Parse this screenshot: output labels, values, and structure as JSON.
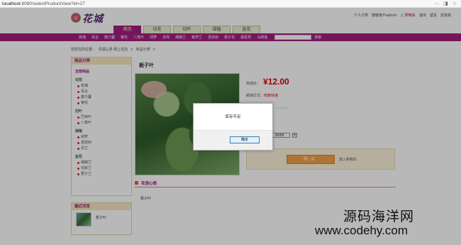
{
  "browser": {
    "host": "localhost",
    "path": ":8080/selectProductView?id=27"
  },
  "header": {
    "logo_text": "花城",
    "toplinks": [
      "个人订单",
      "尊敬用户admin",
      "购物车",
      "退出",
      "留言",
      "去找找"
    ],
    "tabs": [
      "首页",
      "切花",
      "切叶",
      "绿植",
      "盆花"
    ]
  },
  "catbar": {
    "items": [
      "玫瑰",
      "百合",
      "康乃馨",
      "菊花",
      "八角叶",
      "绿萝",
      "多肉",
      "蝴蝶兰",
      "紫罗兰",
      "发财树",
      "栀子花",
      "桑蛇草",
      "马蹄莲"
    ],
    "search_label": "搜索"
  },
  "breadcrumb": [
    "您现在的位置：",
    "花语心愿·网上花店",
    ">",
    "商品分类",
    ">"
  ],
  "sidebar": {
    "heading": "商品分类",
    "all": "全部商品",
    "groups": [
      {
        "title": "切花",
        "items": [
          "玫瑰",
          "百合",
          "康乃馨",
          "菊花"
        ]
      },
      {
        "title": "切叶",
        "items": [
          "巴西叶",
          "八角叶"
        ]
      },
      {
        "title": "绿植",
        "items": [
          "绿萝",
          "发财树",
          "吊兰"
        ]
      },
      {
        "title": "盆花",
        "items": [
          "蝴蝶兰",
          "石斛兰",
          "栀子兰"
        ]
      }
    ]
  },
  "recent": {
    "heading": "最近浏览",
    "item": "栀子叶"
  },
  "product": {
    "title": "栀子叶",
    "price_label": "商城价：",
    "price": "¥12.00",
    "ship_label": "邮递方式：",
    "ship_value": "商家快递",
    "rate": "☆☆☆☆",
    "qty": "6666",
    "qty_plus": "+",
    "buy_label": "购买",
    "cart_label": "放入购物车"
  },
  "detail": {
    "heading": "花语心情",
    "text": "栀子叶"
  },
  "modal": {
    "message": "库存不足",
    "ok": "确定"
  },
  "watermark": {
    "line1": "源码海洋网",
    "line2": "www.codehy.com"
  },
  "colors": {
    "brand": "#a21f7e",
    "price": "#dd0000",
    "tab_bg": "#e8f0d4"
  }
}
